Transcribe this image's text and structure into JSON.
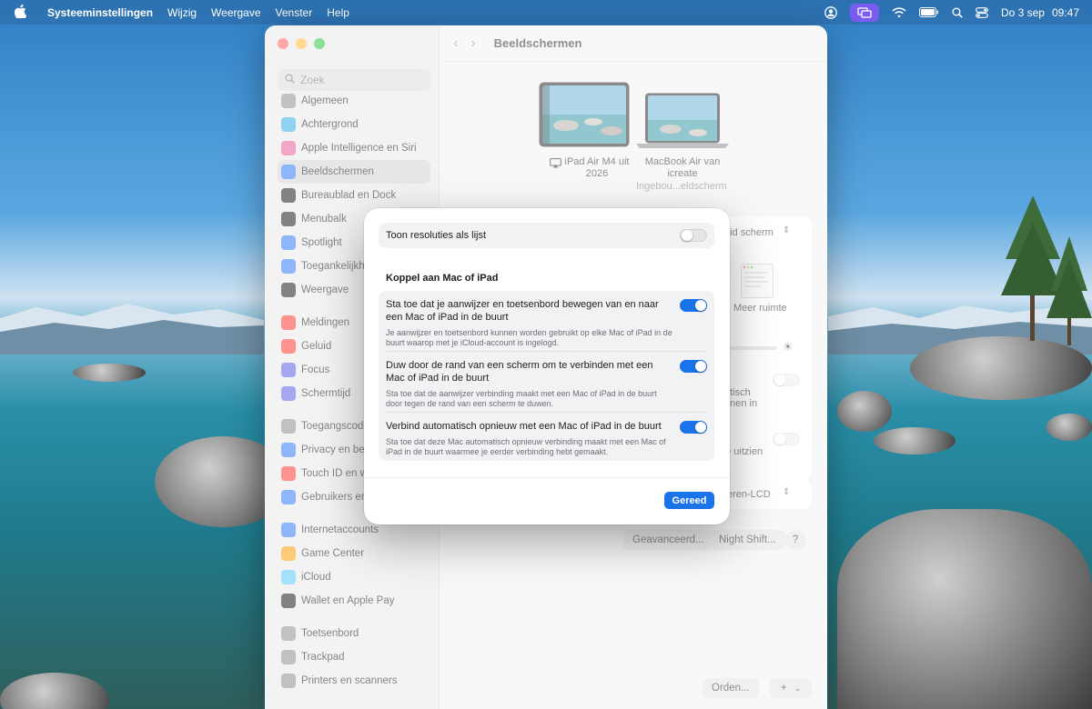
{
  "menubar": {
    "app_name": "Systeeminstellingen",
    "menus": [
      "Wijzig",
      "Weergave",
      "Venster",
      "Help"
    ],
    "date": "Do 3 sep",
    "time": "09:47"
  },
  "window": {
    "search_placeholder": "Zoek",
    "title": "Beeldschermen",
    "sidebar": {
      "items": [
        {
          "label": "Algemeen",
          "icon": "gear-icon",
          "color": "#8e8e93"
        },
        {
          "label": "Achtergrond",
          "icon": "wallpaper-icon",
          "color": "#32ade6"
        },
        {
          "label": "Apple Intelligence en Siri",
          "icon": "siri-icon",
          "color": "#e85d9c"
        },
        {
          "label": "Beeldschermen",
          "icon": "display-icon",
          "color": "#3478f6"
        },
        {
          "label": "Bureaublad en Dock",
          "icon": "dock-icon",
          "color": "#1c1c1e"
        },
        {
          "label": "Menubalk",
          "icon": "menubar-icon",
          "color": "#1c1c1e"
        },
        {
          "label": "Spotlight",
          "icon": "spotlight-icon",
          "color": "#3478f6"
        },
        {
          "label": "Toegankelijkheid",
          "icon": "accessibility-icon",
          "color": "#3478f6"
        },
        {
          "label": "Weergave",
          "icon": "appearance-icon",
          "color": "#1c1c1e"
        },
        {
          "label": "Meldingen",
          "icon": "bell-icon",
          "color": "#ff3b30"
        },
        {
          "label": "Geluid",
          "icon": "speaker-icon",
          "color": "#ff3b30"
        },
        {
          "label": "Focus",
          "icon": "moon-icon",
          "color": "#5e5ce6"
        },
        {
          "label": "Schermtijd",
          "icon": "hourglass-icon",
          "color": "#5e5ce6"
        },
        {
          "label": "Toegangscode",
          "icon": "lock-icon",
          "color": "#8e8e93"
        },
        {
          "label": "Privacy en beveiliging",
          "icon": "hand-icon",
          "color": "#3478f6"
        },
        {
          "label": "Touch ID en wachtwoord",
          "icon": "fingerprint-icon",
          "color": "#ff3b30"
        },
        {
          "label": "Gebruikers en groepen",
          "icon": "users-icon",
          "color": "#3478f6"
        },
        {
          "label": "Internetaccounts",
          "icon": "at-icon",
          "color": "#3478f6"
        },
        {
          "label": "Game Center",
          "icon": "gamecenter-icon",
          "color": "#ff9f0a"
        },
        {
          "label": "iCloud",
          "icon": "cloud-icon",
          "color": "#5ac8fa"
        },
        {
          "label": "Wallet en Apple Pay",
          "icon": "wallet-icon",
          "color": "#1c1c1e"
        },
        {
          "label": "Toetsenbord",
          "icon": "keyboard-icon",
          "color": "#8e8e93"
        },
        {
          "label": "Trackpad",
          "icon": "trackpad-icon",
          "color": "#8e8e93"
        },
        {
          "label": "Printers en scanners",
          "icon": "printer-icon",
          "color": "#8e8e93"
        }
      ]
    },
    "displays": [
      {
        "label": "iPad Air M4 uit 2026"
      },
      {
        "label": "MacBook Air van icreate",
        "sub": "Ingebou...eldscherm"
      }
    ],
    "background": {
      "resolution_select": "eid scherm",
      "more_space": "Meer ruimte",
      "partial_1": "utisch",
      "partial_2": "nnen in",
      "partial_3": "de uitzien",
      "profile_select": "eren-LCD",
      "advanced_button": "Geavanceerd...",
      "night_shift_button": "Night Shift...",
      "help_button": "?",
      "arrange_button": "Orden...",
      "add_button": "+"
    }
  },
  "modal": {
    "show_list": {
      "label": "Toon resoluties als lijst",
      "on": false
    },
    "section_title": "Koppel aan Mac of iPad",
    "options": [
      {
        "title": "Sta toe dat je aanwijzer en toetsenbord bewegen van en naar een Mac of iPad in de buurt",
        "desc": "Je aanwijzer en toetsenbord kunnen worden gebruikt op elke Mac of iPad in de buurt waarop met je iCloud-account is ingelogd.",
        "on": true
      },
      {
        "title": "Duw door de rand van een scherm om te verbinden met een Mac of iPad in de buurt",
        "desc": "Sta toe dat de aanwijzer verbinding maakt met een Mac of iPad in de buurt door tegen de rand van een scherm te duwen.",
        "on": true
      },
      {
        "title": "Verbind automatisch opnieuw met een Mac of iPad in de buurt",
        "desc": "Sta toe dat deze Mac automatisch opnieuw verbinding maakt met een Mac of iPad in de buurt waarmee je eerder verbinding hebt gemaakt.",
        "on": true
      }
    ],
    "done_label": "Gereed"
  }
}
